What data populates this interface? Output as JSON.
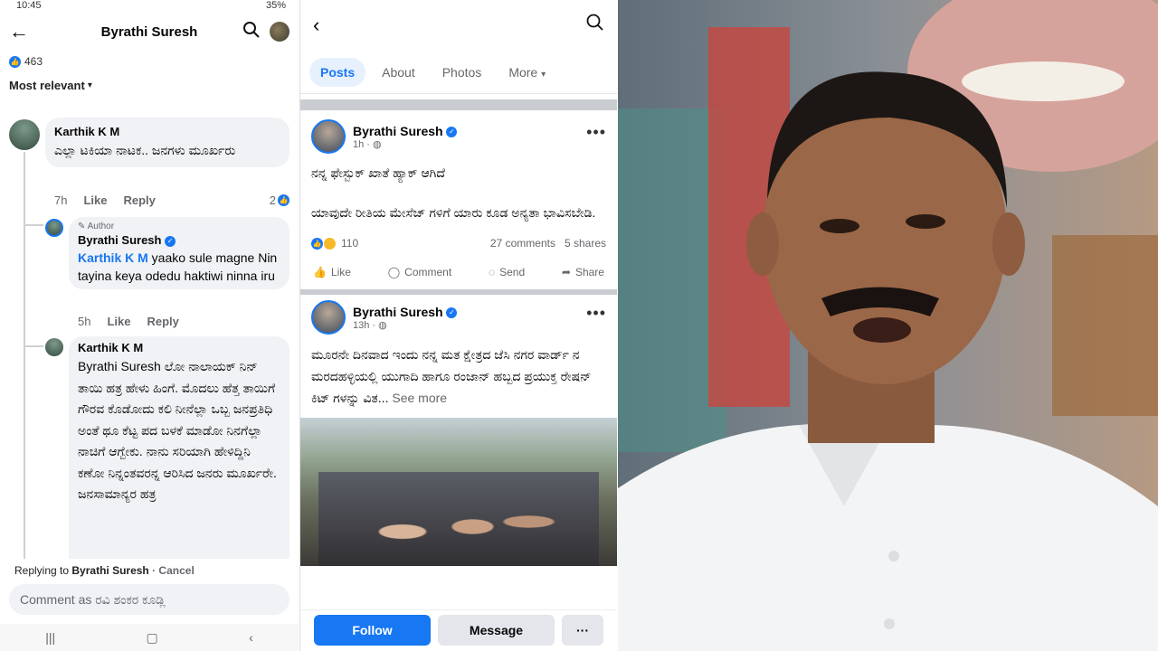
{
  "status": {
    "time": "10:45",
    "battery": "35%"
  },
  "left": {
    "title": "Byrathi Suresh",
    "likes_count": "463",
    "sort_label": "Most relevant",
    "comments": [
      {
        "name": "Karthik K M",
        "text": "ಎಲ್ಲಾ ಟಕಿಯಾ ನಾಟಕ.. ಜನಗಳು ಮೂರ್ಖರು",
        "time": "7h",
        "like": "Like",
        "reply": "Reply",
        "reactions": "2"
      },
      {
        "author_tag": "Author",
        "name": "Byrathi Suresh",
        "mention": "Karthik K M",
        "text": " yaako sule magne Nin tayina keya odedu haktiwi ninna iru",
        "time": "5h",
        "like": "Like",
        "reply": "Reply"
      },
      {
        "name": "Karthik K M",
        "text": "Byrathi Suresh ಲೋ ನಾಲಾಯಕ್ ನಿನ್ ತಾಯಿ ಹತ್ರ ಹೇಳು ಹಿಂಗೆ. ಮೊದಲು ಹೆತ್ತ ತಾಯಿಗೆ ಗೌರವ ಕೊಡೋದು ಕಲಿ ನೀನೆಲ್ಲಾ ಒಬ್ಬ ಜನಪ್ರತಿಧಿ ಅಂತೆ ಥೂ ಕೆಟ್ಟ ಪದ ಬಳಕೆ ಮಾಡೋ ನಿನಗೆಲ್ಲಾ ನಾಚಿಗೆ ಆಗ್ಬೇಕು.  ನಾನು ಸರಿಯಾಗಿ ಹೇಳಿದ್ದಿನಿ ಕಣೋ ನಿನ್ನಂತವರನ್ನ ಆರಿಸಿದ ಜನರು ಮೂರ್ಖರೇ. ಜನಸಾಮಾನ್ಯರ ಹತ್ರ"
      }
    ],
    "replying_prefix": "Replying to",
    "replying_name": "Byrathi Suresh",
    "cancel": "· Cancel",
    "input_placeholder": "Comment as ರವಿ ಶಂಕರ ಕೂಡ್ಲಿ"
  },
  "mid": {
    "tabs": [
      "Posts",
      "About",
      "Photos",
      "More"
    ],
    "posts": [
      {
        "name": "Byrathi Suresh",
        "time": "1h ·",
        "line1": "ನನ್ನ ಫೇಸ್ಬುಕ್ ಖಾತೆ ಹ್ಯಾಕ್ ಆಗಿದೆ",
        "line2": "ಯಾವುದೇ ರೀತಿಯ ಮೇಸೆಜ್ ಗಳಿಗೆ ಯಾರು ಕೂಡ ಅನ್ಯತಾ ಭಾವಿಸಬೇಡಿ.",
        "reactions": "110",
        "comments": "27 comments",
        "shares": "5 shares",
        "actions": [
          "Like",
          "Comment",
          "Send",
          "Share"
        ]
      },
      {
        "name": "Byrathi Suresh",
        "time": "13h ·",
        "text": "ಮೂರನೇ ದಿನವಾದ ಇಂದು ನನ್ನ ಮತ ಕ್ಷೇತ್ರದ ಜೆಸಿ ನಗರ ವಾರ್ಡ್ ನ ಮರದಹಳ್ಳಿಯಲ್ಲಿ ಯುಗಾದಿ ಹಾಗೂ ರಂಜಾನ್ ಹಬ್ಬದ ಪ್ರಯುಕ್ತ ರೇಷನ್ ಕಿಟ್ ಗಳನ್ನು ವಿತ...",
        "see_more": "See more"
      }
    ],
    "buttons": {
      "follow": "Follow",
      "message": "Message",
      "more": "···"
    }
  },
  "colors": {
    "fb_blue": "#1877f2",
    "bubble": "#f0f2f5",
    "muted": "#65676b"
  }
}
